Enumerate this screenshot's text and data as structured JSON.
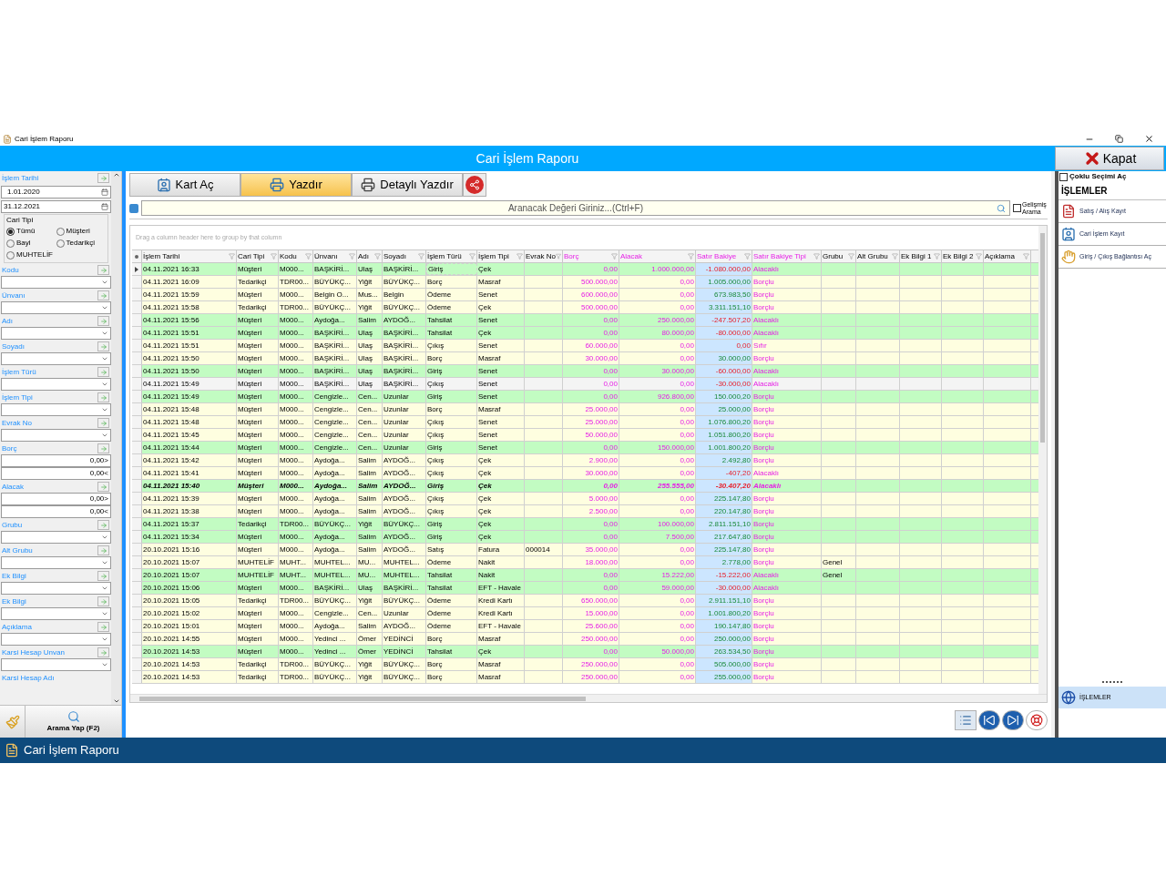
{
  "window": {
    "title": "Cari İşlem Raporu",
    "header": "Cari İşlem Raporu",
    "close_button": "Kapat",
    "taskbar_title": "Cari İşlem Raporu"
  },
  "filters": [
    {
      "kind": "date",
      "label": "İşlem Tarihi",
      "values": [
        "1.01.2020",
        "31.12.2021"
      ]
    },
    {
      "kind": "radio",
      "label": "Cari Tipi",
      "options": [
        {
          "label": "Tümü",
          "selected": true
        },
        {
          "label": "Müşteri",
          "selected": false
        },
        {
          "label": "Bayi",
          "selected": false
        },
        {
          "label": "Tedarikçi",
          "selected": false
        },
        {
          "label": "MUHTELİF",
          "selected": false
        }
      ]
    },
    {
      "kind": "combo",
      "label": "Kodu"
    },
    {
      "kind": "combo",
      "label": "Ünvanı"
    },
    {
      "kind": "combo",
      "label": "Adı"
    },
    {
      "kind": "combo",
      "label": "Soyadı"
    },
    {
      "kind": "combo",
      "label": "İşlem Türü"
    },
    {
      "kind": "combo",
      "label": "İşlem Tipi"
    },
    {
      "kind": "combo",
      "label": "Evrak No"
    },
    {
      "kind": "range",
      "label": "Borç",
      "values": [
        "0,00>",
        "0,00<"
      ]
    },
    {
      "kind": "range",
      "label": "Alacak",
      "values": [
        "0,00>",
        "0,00<"
      ]
    },
    {
      "kind": "combo",
      "label": "Grubu"
    },
    {
      "kind": "combo",
      "label": "Alt Grubu"
    },
    {
      "kind": "combo",
      "label": "Ek Bilgi"
    },
    {
      "kind": "combo",
      "label": "Ek Bilgi"
    },
    {
      "kind": "combo",
      "label": "Açıklama"
    },
    {
      "kind": "combo",
      "label": "Karsi Hesap Unvan"
    },
    {
      "kind": "label",
      "label": "Karsi Hesap Adı"
    }
  ],
  "search_button": "Arama Yap (F2)",
  "toolbar": [
    {
      "label": "Kart Aç",
      "kind": "card",
      "selected": false
    },
    {
      "label": "Yazdır",
      "kind": "print",
      "selected": true
    },
    {
      "label": "Detaylı Yazdır",
      "kind": "detail_print",
      "selected": false
    },
    {
      "kind": "share",
      "selected": false
    }
  ],
  "search": {
    "placeholder": "Aranacak Değeri Giriniz...(Ctrl+F)",
    "advanced_label": "Gelişmiş Arama",
    "advanced_checked": false
  },
  "group_hint": "Drag a column header here to group by that column",
  "table": {
    "columns": [
      {
        "label": "İşlem Tarihi",
        "kind": "text"
      },
      {
        "label": "Cari Tipi",
        "kind": "text"
      },
      {
        "label": "Kodu",
        "kind": "text"
      },
      {
        "label": "Ünvanı",
        "kind": "text"
      },
      {
        "label": "Adı",
        "kind": "text"
      },
      {
        "label": "Soyadı",
        "kind": "text"
      },
      {
        "label": "İşlem Türü",
        "kind": "text"
      },
      {
        "label": "İşlem Tipi",
        "kind": "text"
      },
      {
        "label": "Evrak No",
        "kind": "text"
      },
      {
        "label": "Borç",
        "kind": "money"
      },
      {
        "label": "Alacak",
        "kind": "money"
      },
      {
        "label": "Satır Bakiye",
        "kind": "balance"
      },
      {
        "label": "Satır Bakiye Tipi",
        "kind": "balance_type"
      },
      {
        "label": "Grubu",
        "kind": "text"
      },
      {
        "label": "Alt Grubu",
        "kind": "text"
      },
      {
        "label": "Ek Bilgi 1",
        "kind": "text"
      },
      {
        "label": "Ek Bilgi 2",
        "kind": "text"
      },
      {
        "label": "Açıklama",
        "kind": "text"
      }
    ],
    "rows": [
      {
        "color": "#c2fcc2",
        "selected": true,
        "bold": false,
        "date": "04.11.2021 16:33",
        "cari_tipi": "Müşteri",
        "kodu": "M000...",
        "unvani": "BAŞKİRİ...",
        "adi": "Ulaş",
        "soyadi": "BAŞKİRİ...",
        "islem_turu": "Giriş",
        "islem_tipi": "Çek",
        "borc": "0,00",
        "alacak": "1.000.000,00",
        "bakiye": {
          "value": "-1.080.000,00",
          "negative": true
        },
        "bakiye_tipi": "Alacaklı"
      },
      {
        "color": "#fefee0",
        "selected": false,
        "bold": false,
        "date": "04.11.2021 16:09",
        "cari_tipi": "Tedarikçi",
        "kodu": "TDR00...",
        "unvani": "BÜYÜKÇ...",
        "adi": "Yiğit",
        "soyadi": "BÜYÜKÇ...",
        "islem_turu": "Borç",
        "islem_tipi": "Masraf",
        "borc": "500.000,00",
        "alacak": "0,00",
        "bakiye": {
          "value": "1.005.000,00",
          "negative": false
        },
        "bakiye_tipi": "Borçlu"
      },
      {
        "color": "#fefee0",
        "selected": false,
        "bold": false,
        "date": "04.11.2021 15:59",
        "cari_tipi": "Müşteri",
        "kodu": "M000...",
        "unvani": "Belgin O...",
        "adi": "Mus...",
        "soyadi": "Belgin",
        "islem_turu": "Ödeme",
        "islem_tipi": "Senet",
        "borc": "600.000,00",
        "alacak": "0,00",
        "bakiye": {
          "value": "673.983,50",
          "negative": false
        },
        "bakiye_tipi": "Borçlu"
      },
      {
        "color": "#fefee0",
        "selected": false,
        "bold": false,
        "date": "04.11.2021 15:58",
        "cari_tipi": "Tedarikçi",
        "kodu": "TDR00...",
        "unvani": "BÜYÜKÇ...",
        "adi": "Yiğit",
        "soyadi": "BÜYÜKÇ...",
        "islem_turu": "Ödeme",
        "islem_tipi": "Çek",
        "borc": "500.000,00",
        "alacak": "0,00",
        "bakiye": {
          "value": "3.311.151,10",
          "negative": false
        },
        "bakiye_tipi": "Borçlu"
      },
      {
        "color": "#c2fcc2",
        "selected": false,
        "bold": false,
        "date": "04.11.2021 15:56",
        "cari_tipi": "Müşteri",
        "kodu": "M000...",
        "unvani": "Aydoğa...",
        "adi": "Salim",
        "soyadi": "AYDOĞ...",
        "islem_turu": "Tahsilat",
        "islem_tipi": "Senet",
        "borc": "0,00",
        "alacak": "250.000,00",
        "bakiye": {
          "value": "-247.507,20",
          "negative": true
        },
        "bakiye_tipi": "Alacaklı"
      },
      {
        "color": "#c2fcc2",
        "selected": false,
        "bold": false,
        "date": "04.11.2021 15:51",
        "cari_tipi": "Müşteri",
        "kodu": "M000...",
        "unvani": "BAŞKİRİ...",
        "adi": "Ulaş",
        "soyadi": "BAŞKİRİ...",
        "islem_turu": "Tahsilat",
        "islem_tipi": "Çek",
        "borc": "0,00",
        "alacak": "80.000,00",
        "bakiye": {
          "value": "-80.000,00",
          "negative": true
        },
        "bakiye_tipi": "Alacaklı"
      },
      {
        "color": "#fefee0",
        "selected": false,
        "bold": false,
        "date": "04.11.2021 15:51",
        "cari_tipi": "Müşteri",
        "kodu": "M000...",
        "unvani": "BAŞKİRİ...",
        "adi": "Ulaş",
        "soyadi": "BAŞKİRİ...",
        "islem_turu": "Çıkış",
        "islem_tipi": "Senet",
        "borc": "60.000,00",
        "alacak": "0,00",
        "bakiye": {
          "value": "0,00",
          "negative": true
        },
        "bakiye_tipi": "Sıfır"
      },
      {
        "color": "#fefee0",
        "selected": false,
        "bold": false,
        "date": "04.11.2021 15:50",
        "cari_tipi": "Müşteri",
        "kodu": "M000...",
        "unvani": "BAŞKİRİ...",
        "adi": "Ulaş",
        "soyadi": "BAŞKİRİ...",
        "islem_turu": "Borç",
        "islem_tipi": "Masraf",
        "borc": "30.000,00",
        "alacak": "0,00",
        "bakiye": {
          "value": "30.000,00",
          "negative": false
        },
        "bakiye_tipi": "Borçlu"
      },
      {
        "color": "#c2fcc2",
        "selected": false,
        "bold": false,
        "date": "04.11.2021 15:50",
        "cari_tipi": "Müşteri",
        "kodu": "M000...",
        "unvani": "BAŞKİRİ...",
        "adi": "Ulaş",
        "soyadi": "BAŞKİRİ...",
        "islem_turu": "Giriş",
        "islem_tipi": "Senet",
        "borc": "0,00",
        "alacak": "30.000,00",
        "bakiye": {
          "value": "-60.000,00",
          "negative": true
        },
        "bakiye_tipi": "Alacaklı"
      },
      {
        "color": "#f4f4f4",
        "selected": false,
        "bold": false,
        "date": "04.11.2021 15:49",
        "cari_tipi": "Müşteri",
        "kodu": "M000...",
        "unvani": "BAŞKİRİ...",
        "adi": "Ulaş",
        "soyadi": "BAŞKİRİ...",
        "islem_turu": "Çıkış",
        "islem_tipi": "Senet",
        "borc": "0,00",
        "alacak": "0,00",
        "bakiye": {
          "value": "-30.000,00",
          "negative": true
        },
        "bakiye_tipi": "Alacaklı"
      },
      {
        "color": "#c2fcc2",
        "selected": false,
        "bold": false,
        "date": "04.11.2021 15:49",
        "cari_tipi": "Müşteri",
        "kodu": "M000...",
        "unvani": "Cengizle...",
        "adi": "Cen...",
        "soyadi": "Uzunlar",
        "islem_turu": "Giriş",
        "islem_tipi": "Senet",
        "borc": "0,00",
        "alacak": "926.800,00",
        "bakiye": {
          "value": "150.000,20",
          "negative": false
        },
        "bakiye_tipi": "Borçlu"
      },
      {
        "color": "#fefee0",
        "selected": false,
        "bold": false,
        "date": "04.11.2021 15:48",
        "cari_tipi": "Müşteri",
        "kodu": "M000...",
        "unvani": "Cengizle...",
        "adi": "Cen...",
        "soyadi": "Uzunlar",
        "islem_turu": "Borç",
        "islem_tipi": "Masraf",
        "borc": "25.000,00",
        "alacak": "0,00",
        "bakiye": {
          "value": "25.000,00",
          "negative": false
        },
        "bakiye_tipi": "Borçlu"
      },
      {
        "color": "#fefee0",
        "selected": false,
        "bold": false,
        "date": "04.11.2021 15:48",
        "cari_tipi": "Müşteri",
        "kodu": "M000...",
        "unvani": "Cengizle...",
        "adi": "Cen...",
        "soyadi": "Uzunlar",
        "islem_turu": "Çıkış",
        "islem_tipi": "Senet",
        "borc": "25.000,00",
        "alacak": "0,00",
        "bakiye": {
          "value": "1.076.800,20",
          "negative": false
        },
        "bakiye_tipi": "Borçlu"
      },
      {
        "color": "#fefee0",
        "selected": false,
        "bold": false,
        "date": "04.11.2021 15:45",
        "cari_tipi": "Müşteri",
        "kodu": "M000...",
        "unvani": "Cengizle...",
        "adi": "Cen...",
        "soyadi": "Uzunlar",
        "islem_turu": "Çıkış",
        "islem_tipi": "Senet",
        "borc": "50.000,00",
        "alacak": "0,00",
        "bakiye": {
          "value": "1.051.800,20",
          "negative": false
        },
        "bakiye_tipi": "Borçlu"
      },
      {
        "color": "#c2fcc2",
        "selected": false,
        "bold": false,
        "date": "04.11.2021 15:44",
        "cari_tipi": "Müşteri",
        "kodu": "M000...",
        "unvani": "Cengizle...",
        "adi": "Cen...",
        "soyadi": "Uzunlar",
        "islem_turu": "Giriş",
        "islem_tipi": "Senet",
        "borc": "0,00",
        "alacak": "150.000,00",
        "bakiye": {
          "value": "1.001.800,20",
          "negative": false
        },
        "bakiye_tipi": "Borçlu"
      },
      {
        "color": "#fefee0",
        "selected": false,
        "bold": false,
        "date": "04.11.2021 15:42",
        "cari_tipi": "Müşteri",
        "kodu": "M000...",
        "unvani": "Aydoğa...",
        "adi": "Salim",
        "soyadi": "AYDOĞ...",
        "islem_turu": "Çıkış",
        "islem_tipi": "Çek",
        "borc": "2.900,00",
        "alacak": "0,00",
        "bakiye": {
          "value": "2.492,80",
          "negative": false
        },
        "bakiye_tipi": "Borçlu"
      },
      {
        "color": "#fefee0",
        "selected": false,
        "bold": false,
        "date": "04.11.2021 15:41",
        "cari_tipi": "Müşteri",
        "kodu": "M000...",
        "unvani": "Aydoğa...",
        "adi": "Salim",
        "soyadi": "AYDOĞ...",
        "islem_turu": "Çıkış",
        "islem_tipi": "Çek",
        "borc": "30.000,00",
        "alacak": "0,00",
        "bakiye": {
          "value": "-407,20",
          "negative": true
        },
        "bakiye_tipi": "Alacaklı"
      },
      {
        "color": "#c2fcc2",
        "selected": false,
        "bold": true,
        "date": "04.11.2021 15:40",
        "cari_tipi": "Müşteri",
        "kodu": "M000...",
        "unvani": "Aydoğa...",
        "adi": "Salim",
        "soyadi": "AYDOĞ...",
        "islem_turu": "Giriş",
        "islem_tipi": "Çek",
        "borc": "0,00",
        "alacak": "255.555,00",
        "bakiye": {
          "value": "-30.407,20",
          "negative": true
        },
        "bakiye_tipi": "Alacaklı"
      },
      {
        "color": "#fefee0",
        "selected": false,
        "bold": false,
        "date": "04.11.2021 15:39",
        "cari_tipi": "Müşteri",
        "kodu": "M000...",
        "unvani": "Aydoğa...",
        "adi": "Salim",
        "soyadi": "AYDOĞ...",
        "islem_turu": "Çıkış",
        "islem_tipi": "Çek",
        "borc": "5.000,00",
        "alacak": "0,00",
        "bakiye": {
          "value": "225.147,80",
          "negative": false
        },
        "bakiye_tipi": "Borçlu"
      },
      {
        "color": "#fefee0",
        "selected": false,
        "bold": false,
        "date": "04.11.2021 15:38",
        "cari_tipi": "Müşteri",
        "kodu": "M000...",
        "unvani": "Aydoğa...",
        "adi": "Salim",
        "soyadi": "AYDOĞ...",
        "islem_turu": "Çıkış",
        "islem_tipi": "Çek",
        "borc": "2.500,00",
        "alacak": "0,00",
        "bakiye": {
          "value": "220.147,80",
          "negative": false
        },
        "bakiye_tipi": "Borçlu"
      },
      {
        "color": "#c2fcc2",
        "selected": false,
        "bold": false,
        "date": "04.11.2021 15:37",
        "cari_tipi": "Tedarikçi",
        "kodu": "TDR00...",
        "unvani": "BÜYÜKÇ...",
        "adi": "Yiğit",
        "soyadi": "BÜYÜKÇ...",
        "islem_turu": "Giriş",
        "islem_tipi": "Çek",
        "borc": "0,00",
        "alacak": "100.000,00",
        "bakiye": {
          "value": "2.811.151,10",
          "negative": false
        },
        "bakiye_tipi": "Borçlu"
      },
      {
        "color": "#c2fcc2",
        "selected": false,
        "bold": false,
        "date": "04.11.2021 15:34",
        "cari_tipi": "Müşteri",
        "kodu": "M000...",
        "unvani": "Aydoğa...",
        "adi": "Salim",
        "soyadi": "AYDOĞ...",
        "islem_turu": "Giriş",
        "islem_tipi": "Çek",
        "borc": "0,00",
        "alacak": "7.500,00",
        "bakiye": {
          "value": "217.647,80",
          "negative": false
        },
        "bakiye_tipi": "Borçlu"
      },
      {
        "color": "#fefee0",
        "selected": false,
        "bold": false,
        "date": "20.10.2021 15:16",
        "cari_tipi": "Müşteri",
        "kodu": "M000...",
        "unvani": "Aydoğa...",
        "adi": "Salim",
        "soyadi": "AYDOĞ...",
        "islem_turu": "Satış",
        "islem_tipi": "Fatura",
        "evrak_no": "000014",
        "borc": "35.000,00",
        "alacak": "0,00",
        "bakiye": {
          "value": "225.147,80",
          "negative": false
        },
        "bakiye_tipi": "Borçlu"
      },
      {
        "color": "#fefee0",
        "selected": false,
        "bold": false,
        "date": "20.10.2021 15:07",
        "cari_tipi": "MUHTELİF",
        "kodu": "MUHT...",
        "unvani": "MUHTEL...",
        "adi": "MU...",
        "soyadi": "MUHTEL...",
        "islem_turu": "Ödeme",
        "islem_tipi": "Nakit",
        "borc": "18.000,00",
        "alacak": "0,00",
        "bakiye": {
          "value": "2.778,00",
          "negative": false
        },
        "bakiye_tipi": "Borçlu",
        "grubu": "Genel"
      },
      {
        "color": "#c2fcc2",
        "selected": false,
        "bold": false,
        "date": "20.10.2021 15:07",
        "cari_tipi": "MUHTELİF",
        "kodu": "MUHT...",
        "unvani": "MUHTEL...",
        "adi": "MU...",
        "soyadi": "MUHTEL...",
        "islem_turu": "Tahsilat",
        "islem_tipi": "Nakit",
        "borc": "0,00",
        "alacak": "15.222,00",
        "bakiye": {
          "value": "-15.222,00",
          "negative": true
        },
        "bakiye_tipi": "Alacaklı",
        "grubu": "Genel"
      },
      {
        "color": "#c2fcc2",
        "selected": false,
        "bold": false,
        "date": "20.10.2021 15:06",
        "cari_tipi": "Müşteri",
        "kodu": "M000...",
        "unvani": "BAŞKİRİ...",
        "adi": "Ulaş",
        "soyadi": "BAŞKİRİ...",
        "islem_turu": "Tahsilat",
        "islem_tipi": "EFT - Havale",
        "borc": "0,00",
        "alacak": "59.000,00",
        "bakiye": {
          "value": "-30.000,00",
          "negative": true
        },
        "bakiye_tipi": "Alacaklı"
      },
      {
        "color": "#fefee0",
        "selected": false,
        "bold": false,
        "date": "20.10.2021 15:05",
        "cari_tipi": "Tedarikçi",
        "kodu": "TDR00...",
        "unvani": "BÜYÜKÇ...",
        "adi": "Yiğit",
        "soyadi": "BÜYÜKÇ...",
        "islem_turu": "Ödeme",
        "islem_tipi": "Kredi Kartı",
        "borc": "650.000,00",
        "alacak": "0,00",
        "bakiye": {
          "value": "2.911.151,10",
          "negative": false
        },
        "bakiye_tipi": "Borçlu"
      },
      {
        "color": "#fefee0",
        "selected": false,
        "bold": false,
        "date": "20.10.2021 15:02",
        "cari_tipi": "Müşteri",
        "kodu": "M000...",
        "unvani": "Cengizle...",
        "adi": "Cen...",
        "soyadi": "Uzunlar",
        "islem_turu": "Ödeme",
        "islem_tipi": "Kredi Kartı",
        "borc": "15.000,00",
        "alacak": "0,00",
        "bakiye": {
          "value": "1.001.800,20",
          "negative": false
        },
        "bakiye_tipi": "Borçlu"
      },
      {
        "color": "#fefee0",
        "selected": false,
        "bold": false,
        "date": "20.10.2021 15:01",
        "cari_tipi": "Müşteri",
        "kodu": "M000...",
        "unvani": "Aydoğa...",
        "adi": "Salim",
        "soyadi": "AYDOĞ...",
        "islem_turu": "Ödeme",
        "islem_tipi": "EFT - Havale",
        "borc": "25.600,00",
        "alacak": "0,00",
        "bakiye": {
          "value": "190.147,80",
          "negative": false
        },
        "bakiye_tipi": "Borçlu"
      },
      {
        "color": "#fefee0",
        "selected": false,
        "bold": false,
        "date": "20.10.2021 14:55",
        "cari_tipi": "Müşteri",
        "kodu": "M000...",
        "unvani": "Yedinci ...",
        "adi": "Ömer",
        "soyadi": "YEDİNCİ",
        "islem_turu": "Borç",
        "islem_tipi": "Masraf",
        "borc": "250.000,00",
        "alacak": "0,00",
        "bakiye": {
          "value": "250.000,00",
          "negative": false
        },
        "bakiye_tipi": "Borçlu"
      },
      {
        "color": "#c2fcc2",
        "selected": false,
        "bold": false,
        "date": "20.10.2021 14:53",
        "cari_tipi": "Müşteri",
        "kodu": "M000...",
        "unvani": "Yedinci ...",
        "adi": "Ömer",
        "soyadi": "YEDİNCİ",
        "islem_turu": "Tahsilat",
        "islem_tipi": "Çek",
        "borc": "0,00",
        "alacak": "50.000,00",
        "bakiye": {
          "value": "263.534,50",
          "negative": false
        },
        "bakiye_tipi": "Borçlu"
      },
      {
        "color": "#fefee0",
        "selected": false,
        "bold": false,
        "date": "20.10.2021 14:53",
        "cari_tipi": "Tedarikçi",
        "kodu": "TDR00...",
        "unvani": "BÜYÜKÇ...",
        "adi": "Yiğit",
        "soyadi": "BÜYÜKÇ...",
        "islem_turu": "Borç",
        "islem_tipi": "Masraf",
        "borc": "250.000,00",
        "alacak": "0,00",
        "bakiye": {
          "value": "505.000,00",
          "negative": false
        },
        "bakiye_tipi": "Borçlu"
      },
      {
        "color": "#fefee0",
        "selected": false,
        "bold": false,
        "date": "20.10.2021 14:53",
        "cari_tipi": "Tedarikçi",
        "kodu": "TDR00...",
        "unvani": "BÜYÜKÇ...",
        "adi": "Yiğit",
        "soyadi": "BÜYÜKÇ...",
        "islem_turu": "Borç",
        "islem_tipi": "Masraf",
        "borc": "250.000,00",
        "alacak": "0,00",
        "bakiye": {
          "value": "255.000,00",
          "negative": false
        },
        "bakiye_tipi": "Borçlu"
      }
    ]
  },
  "side_panel": {
    "multi_select_label": "Çoklu Seçimi Aç",
    "multi_select_checked": false,
    "heading": "İŞLEMLER",
    "items": [
      {
        "label": "Satış / Alış Kayıt",
        "kind": "invoice"
      },
      {
        "label": "Cari İşlem Kayıt",
        "kind": "contact"
      },
      {
        "label": "Giriş / Çıkış Bağlantısı Aç",
        "kind": "hand"
      }
    ],
    "groups": [
      {
        "label": "İŞLEMLER",
        "selected": true
      }
    ]
  },
  "nav_buttons": [
    {
      "kind": "list"
    },
    {
      "kind": "first"
    },
    {
      "kind": "last"
    },
    {
      "kind": "help"
    }
  ]
}
